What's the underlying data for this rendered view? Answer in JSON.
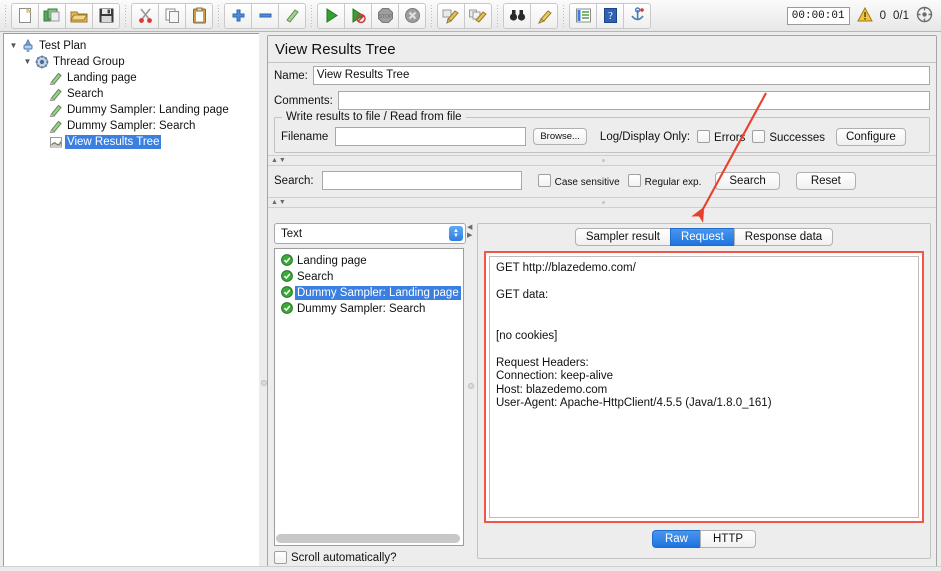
{
  "toolbar": {
    "buttons": [
      {
        "name": "new",
        "icon": "new-document-icon"
      },
      {
        "name": "templates",
        "icon": "templates-icon"
      },
      {
        "name": "open",
        "icon": "open-folder-icon"
      },
      {
        "name": "save",
        "icon": "save-disk-icon"
      },
      {
        "name": "cut",
        "icon": "scissors-icon"
      },
      {
        "name": "copy",
        "icon": "copy-icon"
      },
      {
        "name": "paste",
        "icon": "clipboard-paste-icon"
      },
      {
        "name": "expand-all",
        "icon": "plus-icon"
      },
      {
        "name": "collapse-all",
        "icon": "minus-icon"
      },
      {
        "name": "toggle",
        "icon": "toggle-pencil-icon"
      },
      {
        "name": "start",
        "icon": "play-green-icon"
      },
      {
        "name": "start-no-pauses",
        "icon": "play-no-pause-icon"
      },
      {
        "name": "stop",
        "icon": "stop-sign-icon"
      },
      {
        "name": "shutdown",
        "icon": "shutdown-x-icon"
      },
      {
        "name": "clear",
        "icon": "clear-broom-icon"
      },
      {
        "name": "clear-all",
        "icon": "clear-all-broom-icon"
      },
      {
        "name": "search",
        "icon": "binoculars-icon"
      },
      {
        "name": "reset-search",
        "icon": "reset-broom-icon"
      },
      {
        "name": "function-helper",
        "icon": "function-list-icon"
      },
      {
        "name": "help",
        "icon": "help-book-icon"
      },
      {
        "name": "undo-redo",
        "icon": "anchor-icon"
      }
    ],
    "timer": "00:00:01",
    "warning_count": "0",
    "thread_ratio": "0/1",
    "warning_icon": "warning-triangle-icon",
    "connect_icon": "connections-icon"
  },
  "tree": {
    "nodes": [
      {
        "label": "Test Plan",
        "depth": 0,
        "twisty": "▼",
        "icon": "test-plan-icon",
        "selected": false
      },
      {
        "label": "Thread Group",
        "depth": 1,
        "twisty": "▼",
        "icon": "thread-group-icon",
        "selected": false
      },
      {
        "label": "Landing page",
        "depth": 2,
        "twisty": "",
        "icon": "sampler-icon",
        "selected": false
      },
      {
        "label": "Search",
        "depth": 2,
        "twisty": "",
        "icon": "sampler-icon",
        "selected": false
      },
      {
        "label": "Dummy Sampler: Landing page",
        "depth": 2,
        "twisty": "",
        "icon": "sampler-icon",
        "selected": false
      },
      {
        "label": "Dummy Sampler: Search",
        "depth": 2,
        "twisty": "",
        "icon": "sampler-icon",
        "selected": false
      },
      {
        "label": "View Results Tree",
        "depth": 2,
        "twisty": "",
        "icon": "view-results-tree-icon",
        "selected": true
      }
    ]
  },
  "panel": {
    "title": "View Results Tree",
    "name_label": "Name:",
    "name_value": "View Results Tree",
    "comments_label": "Comments:",
    "comments_value": "",
    "file_group_title": "Write results to file / Read from file",
    "filename_label": "Filename",
    "filename_value": "",
    "browse_label": "Browse...",
    "log_display_label": "Log/Display Only:",
    "errors_label": "Errors",
    "errors_checked": false,
    "successes_label": "Successes",
    "successes_checked": false,
    "configure_label": "Configure"
  },
  "search": {
    "label": "Search:",
    "value": "",
    "case_sensitive_label": "Case sensitive",
    "case_sensitive_checked": false,
    "regex_label": "Regular exp.",
    "regex_checked": false,
    "search_button": "Search",
    "reset_button": "Reset"
  },
  "results": {
    "renderer_selected": "Text",
    "items": [
      {
        "label": "Landing page",
        "status": "success",
        "selected": false
      },
      {
        "label": "Search",
        "status": "success",
        "selected": false
      },
      {
        "label": "Dummy Sampler: Landing page",
        "status": "success",
        "selected": true
      },
      {
        "label": "Dummy Sampler: Search",
        "status": "success",
        "selected": false
      }
    ],
    "scroll_auto_label": "Scroll automatically?",
    "scroll_auto_checked": false
  },
  "detail": {
    "tabs": [
      {
        "label": "Sampler result",
        "active": false
      },
      {
        "label": "Request",
        "active": true
      },
      {
        "label": "Response data",
        "active": false
      }
    ],
    "request_text": "GET http://blazedemo.com/\n\nGET data:\n\n\n[no cookies]\n\nRequest Headers:\nConnection: keep-alive\nHost: blazedemo.com\nUser-Agent: Apache-HttpClient/4.5.5 (Java/1.8.0_161)",
    "view_modes": [
      {
        "label": "Raw",
        "active": true
      },
      {
        "label": "HTTP",
        "active": false
      }
    ]
  },
  "annotation": {
    "arrow_color": "#e8402a",
    "highlight_color": "#f0574a"
  },
  "colors": {
    "accent_blue": "#2f7fe2",
    "selection_blue": "#3b7fe0",
    "success_green": "#3aaa35",
    "window_bg": "#ececec"
  }
}
